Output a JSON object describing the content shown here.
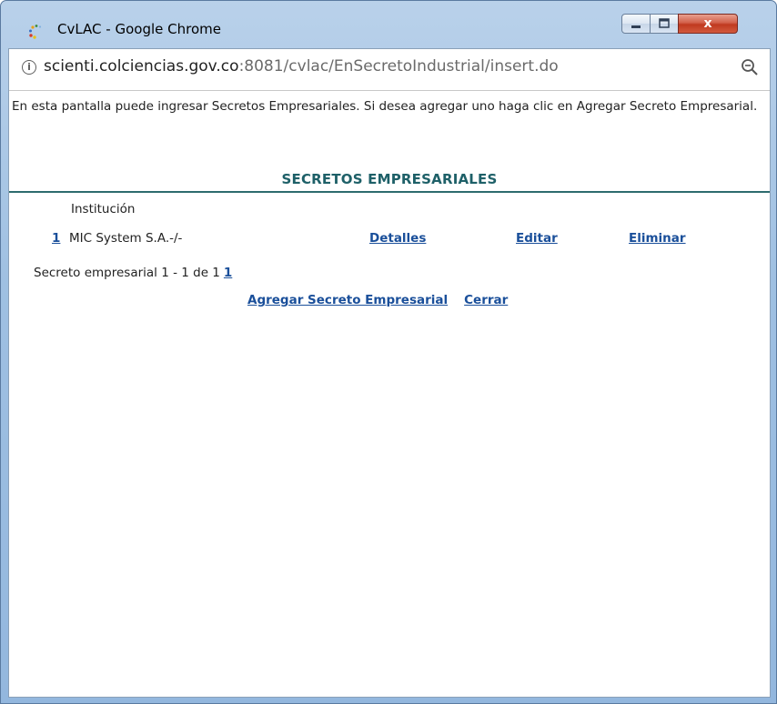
{
  "window": {
    "title": "CvLAC - Google Chrome",
    "close_symbol": "x",
    "accent_color": "#2d6b6e",
    "link_color": "#1a4f9a"
  },
  "addressbar": {
    "info_symbol": "i",
    "url_host": "scienti.colciencias.gov.co",
    "url_rest": ":8081/cvlac/EnSecretoIndustrial/insert.do",
    "zoom_icon": "zoom-out-icon"
  },
  "page": {
    "intro": "En esta pantalla puede ingresar Secretos Empresariales. Si desea agregar uno haga clic en Agregar Secreto Empresarial.",
    "heading": "SECRETOS EMPRESARIALES",
    "column_header": "Institución",
    "rows": [
      {
        "number": "1",
        "institution": "MIC System S.A.-/-",
        "details": "Detalles",
        "edit": "Editar",
        "delete": "Eliminar"
      }
    ],
    "pager_text": "Secreto empresarial 1 - 1 de 1",
    "pager_page": "1",
    "add_link": "Agregar Secreto Empresarial",
    "close_link": "Cerrar"
  }
}
